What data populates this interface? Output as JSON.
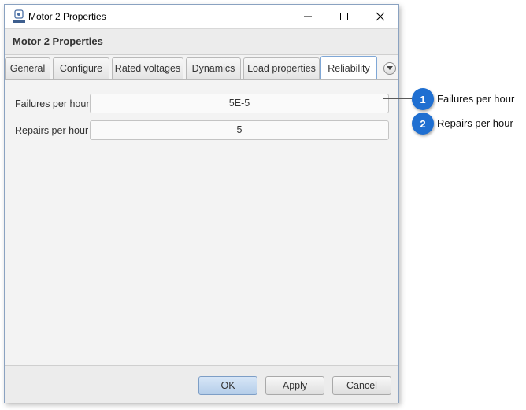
{
  "window": {
    "title": "Motor 2 Properties",
    "header_title": "Motor 2 Properties",
    "controls": [
      "minimize-icon",
      "maximize-icon",
      "close-icon"
    ]
  },
  "tabs": [
    {
      "label": "General",
      "active": false
    },
    {
      "label": "Configure",
      "active": false
    },
    {
      "label": "Rated voltages",
      "active": false
    },
    {
      "label": "Dynamics",
      "active": false
    },
    {
      "label": "Load properties",
      "active": false
    },
    {
      "label": "Reliability",
      "active": true
    }
  ],
  "fields": {
    "failures": {
      "label": "Failures per hour",
      "value": "5E-5"
    },
    "repairs": {
      "label": "Repairs per hour",
      "value": "5"
    }
  },
  "buttons": {
    "ok": "OK",
    "apply": "Apply",
    "cancel": "Cancel"
  },
  "callouts": [
    {
      "number": "1",
      "text": "Failures per hour"
    },
    {
      "number": "2",
      "text": "Repairs per hour"
    }
  ],
  "colors": {
    "accent": "#1f6fd1",
    "active_tab_border": "#7fa7d6",
    "ok_button": "#b4cde9"
  }
}
